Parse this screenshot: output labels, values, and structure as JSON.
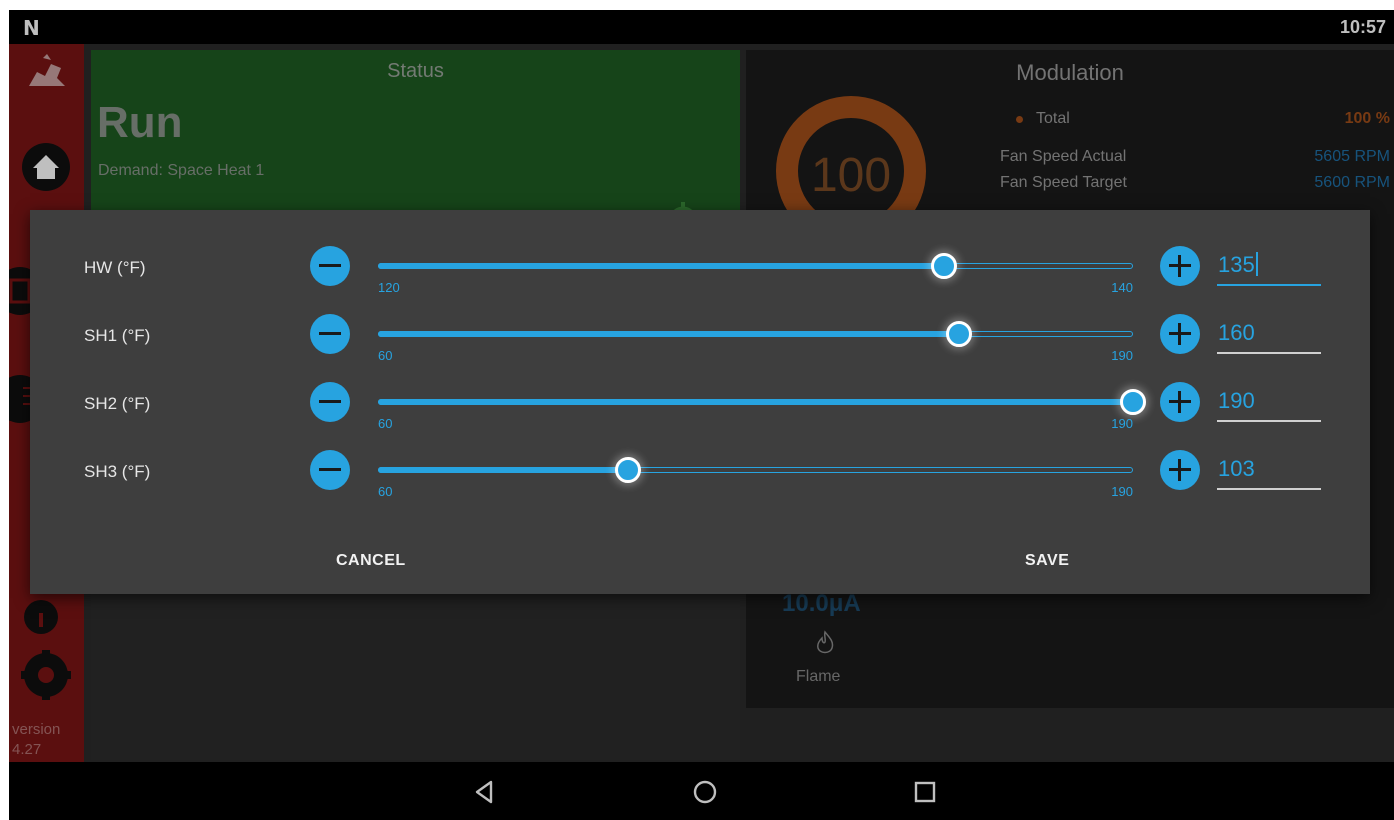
{
  "statusbar": {
    "logo": "N",
    "time": "10:57"
  },
  "sidebar": {
    "version_label": "version",
    "version_number": "4.27"
  },
  "status_panel": {
    "title": "Status",
    "state": "Run",
    "demand": "Demand: Space Heat 1"
  },
  "modulation": {
    "title": "Modulation",
    "gauge_value": "100",
    "total_label": "Total",
    "total_value": "100 %",
    "fan_actual_label": "Fan Speed Actual",
    "fan_actual_value": "5605 RPM",
    "fan_target_label": "Fan Speed Target",
    "fan_target_value": "5600 RPM",
    "flame_value": "10.0μA",
    "flame_label": "Flame"
  },
  "colors": {
    "accent": "#27a3e0",
    "sidebar": "#7a1515",
    "status_green": "#1e5b22",
    "gauge_orange": "#a14e1a"
  },
  "dialog": {
    "rows": [
      {
        "label": "HW (°F)",
        "min": 120,
        "max": 140,
        "value": 135,
        "min_label": "120",
        "max_label": "140",
        "value_text": "135",
        "active": true
      },
      {
        "label": "SH1 (°F)",
        "min": 60,
        "max": 190,
        "value": 160,
        "min_label": "60",
        "max_label": "190",
        "value_text": "160",
        "active": false
      },
      {
        "label": "SH2 (°F)",
        "min": 60,
        "max": 190,
        "value": 190,
        "min_label": "60",
        "max_label": "190",
        "value_text": "190",
        "active": false
      },
      {
        "label": "SH3 (°F)",
        "min": 60,
        "max": 190,
        "value": 103,
        "min_label": "60",
        "max_label": "190",
        "value_text": "103",
        "active": false
      }
    ],
    "cancel_label": "CANCEL",
    "save_label": "SAVE"
  },
  "navbar": {
    "icons": [
      "back-icon",
      "home-icon",
      "recents-icon"
    ]
  }
}
